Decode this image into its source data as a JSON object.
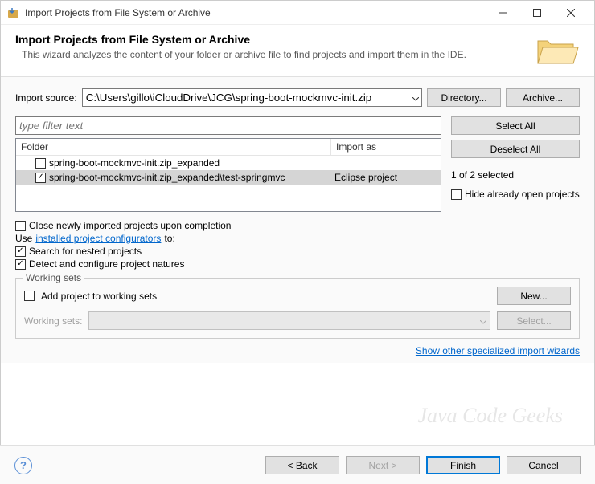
{
  "window": {
    "title": "Import Projects from File System or Archive"
  },
  "banner": {
    "title": "Import Projects from File System or Archive",
    "desc": "This wizard analyzes the content of your folder or archive file to find projects and import them in the IDE."
  },
  "source": {
    "label": "Import source:",
    "value": "C:\\Users\\gillo\\iCloudDrive\\JCG\\spring-boot-mockmvc-init.zip",
    "directory_btn": "Directory...",
    "archive_btn": "Archive..."
  },
  "filter": {
    "placeholder": "type filter text"
  },
  "tree": {
    "header_folder": "Folder",
    "header_import": "Import as",
    "rows": [
      {
        "checked": false,
        "folder": "spring-boot-mockmvc-init.zip_expanded",
        "import_as": ""
      },
      {
        "checked": true,
        "folder": "spring-boot-mockmvc-init.zip_expanded\\test-springmvc",
        "import_as": "Eclipse project"
      }
    ]
  },
  "side": {
    "select_all": "Select All",
    "deselect_all": "Deselect All",
    "selection_info": "1 of 2 selected",
    "hide_open": "Hide already open projects"
  },
  "options": {
    "close_on_complete": "Close newly imported projects upon completion",
    "use_prefix": "Use ",
    "configurators_link": "installed project configurators",
    "use_suffix": " to:",
    "search_nested": "Search for nested projects",
    "detect_natures": "Detect and configure project natures"
  },
  "working_sets": {
    "legend": "Working sets",
    "add_label": "Add project to working sets",
    "new_btn": "New...",
    "combo_label": "Working sets:",
    "select_btn": "Select..."
  },
  "show_link": "Show other specialized import wizards",
  "footer": {
    "back": "< Back",
    "next": "Next >",
    "finish": "Finish",
    "cancel": "Cancel"
  },
  "watermark": "Java Code Geeks"
}
